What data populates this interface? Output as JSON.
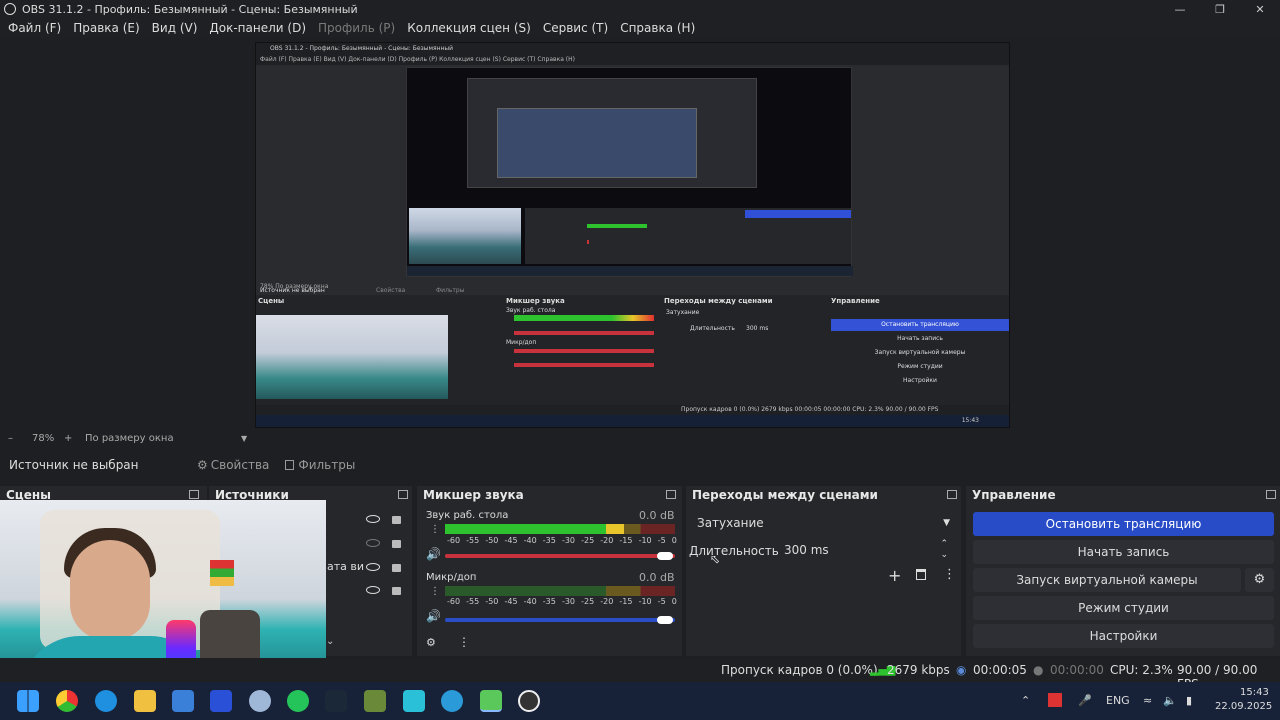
{
  "window": {
    "title": "OBS 31.1.2 - Профиль: Безымянный - Сцены: Безымянный"
  },
  "menu": [
    {
      "label": "Файл (F)",
      "disabled": false
    },
    {
      "label": "Правка (E)",
      "disabled": false
    },
    {
      "label": "Вид (V)",
      "disabled": false
    },
    {
      "label": "Док-панели (D)",
      "disabled": false
    },
    {
      "label": "Профиль (P)",
      "disabled": true
    },
    {
      "label": "Коллекция сцен (S)",
      "disabled": false
    },
    {
      "label": "Сервис (T)",
      "disabled": false
    },
    {
      "label": "Справка (H)",
      "disabled": false
    }
  ],
  "preview": {
    "inner_title": "OBS 31.1.2 - Профиль: Безымянный - Сцены: Безымянный",
    "inner_menu": "Файл (F)   Правка (E)   Вид (V)   Док-панели (D)   Профиль (P)   Коллекция сцен (S)   Сервис (T)   Справка (H)",
    "inner_zoom": "78%   По размеру окна",
    "inner_nosource": "Источник не выбран",
    "inner_props": "Свойства",
    "inner_filters": "Фильтры",
    "inner_scenes": "Сцены",
    "inner_mixer": "Микшер звука",
    "inner_transitions": "Переходы между сценами",
    "inner_controls": "Управление",
    "inner_desktop": "Звук раб. стола",
    "inner_mic": "Микр/доп",
    "inner_fade": "Затухание",
    "inner_duration": "Длительность",
    "inner_duration_val": "300 ms",
    "inner_stop": "Остановить трансляцию",
    "inner_record": "Начать запись",
    "inner_vcam": "Запуск виртуальной камеры",
    "inner_studio": "Режим студии",
    "inner_settings": "Настройки",
    "inner_status": "Пропуск кадров 0 (0.0%)   2679 kbps   00:00:05   00:00:00   CPU: 2.3%   90.00 / 90.00 FPS",
    "inner_clock": "15:43"
  },
  "zoom": {
    "value": "78%",
    "mode": "По размеру окна"
  },
  "source_toolbar": {
    "no_source": "Источник не выбран",
    "properties": "Свойства",
    "filters": "Фильтры"
  },
  "docks": {
    "scenes": "Сцены",
    "sources": "Источники",
    "source_partial": "ата ви",
    "mixer": "Микшер звука",
    "transitions": "Переходы между сценами",
    "controls": "Управление"
  },
  "mixer": {
    "channels": [
      {
        "name": "Звук раб. стола",
        "db": "0.0 dB",
        "level_pct": 78,
        "volume": 1.0
      },
      {
        "name": "Микр/доп",
        "db": "0.0 dB",
        "level_pct": 0,
        "volume": 1.0
      }
    ],
    "scale": [
      "-60",
      "-55",
      "-50",
      "-45",
      "-40",
      "-35",
      "-30",
      "-25",
      "-20",
      "-15",
      "-10",
      "-5",
      "0"
    ]
  },
  "transitions": {
    "selected": "Затухание",
    "duration_label": "Длительность",
    "duration_value": "300 ms"
  },
  "controls": {
    "stop_stream": "Остановить трансляцию",
    "start_record": "Начать запись",
    "virtual_cam": "Запуск виртуальной камеры",
    "studio_mode": "Режим студии",
    "settings": "Настройки"
  },
  "status": {
    "dropped": "Пропуск кадров 0 (0.0%)",
    "bitrate": "2679 kbps",
    "stream_time": "00:00:05",
    "record_time": "00:00:00",
    "cpu": "CPU: 2.3%",
    "fps": "90.00 / 90.00 FPS"
  },
  "tray": {
    "lang": "ENG",
    "time": "15:43",
    "date": "22.09.2025"
  },
  "colors": {
    "accent": "#284cc7",
    "meter_green": "#2ec22e",
    "meter_yellow": "#e8c52a",
    "meter_red": "#e03030"
  }
}
